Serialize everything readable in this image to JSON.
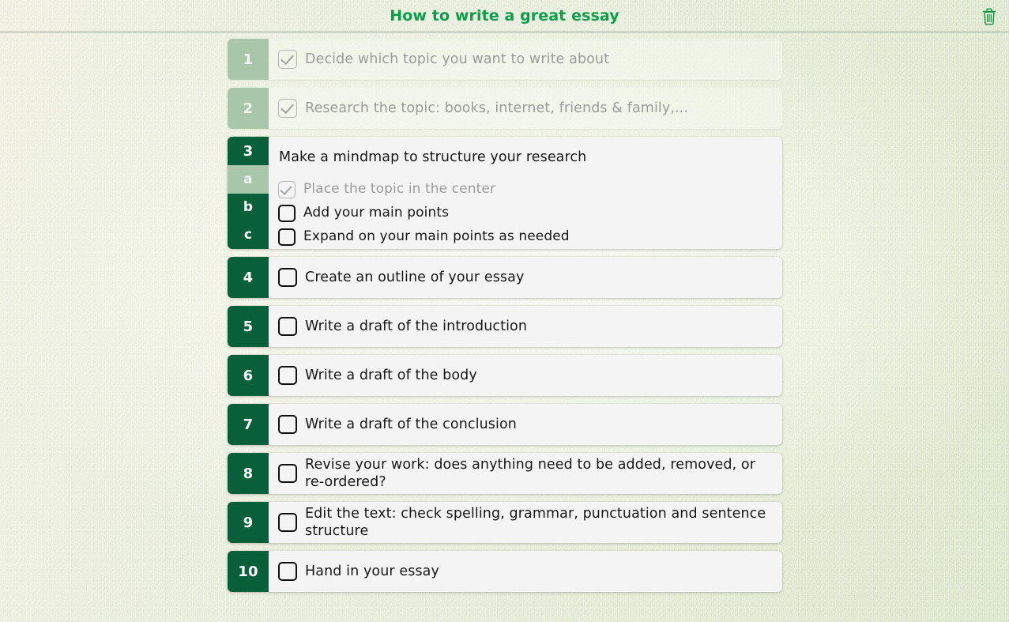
{
  "header": {
    "title": "How to write a great essay",
    "title_color": "#0a9e4a",
    "trash_icon": "trash-icon"
  },
  "theme": {
    "badge_active": "#08603a",
    "badge_done": "#a9c6ab",
    "card_bg": "#f4f4f4",
    "text_active": "#171717",
    "text_done": "#9b9b9b",
    "page_bg": "#eaeedb"
  },
  "checklist": {
    "items": [
      {
        "number": "1",
        "label": "Decide which topic you want to write about",
        "done": true,
        "has_checkbox": true,
        "subitems": []
      },
      {
        "number": "2",
        "label": "Research the topic: books, internet, friends & family,...",
        "done": true,
        "has_checkbox": true,
        "subitems": []
      },
      {
        "number": "3",
        "label": "Make a mindmap to structure your research",
        "done": false,
        "has_checkbox": false,
        "subitems": [
          {
            "number": "a",
            "label": "Place the topic in the center",
            "done": true
          },
          {
            "number": "b",
            "label": "Add your main points",
            "done": false
          },
          {
            "number": "c",
            "label": "Expand on your main points as needed",
            "done": false
          }
        ]
      },
      {
        "number": "4",
        "label": "Create an outline of your essay",
        "done": false,
        "has_checkbox": true,
        "subitems": []
      },
      {
        "number": "5",
        "label": "Write a draft of the introduction",
        "done": false,
        "has_checkbox": true,
        "subitems": []
      },
      {
        "number": "6",
        "label": "Write a draft of the body",
        "done": false,
        "has_checkbox": true,
        "subitems": []
      },
      {
        "number": "7",
        "label": "Write a draft of the conclusion",
        "done": false,
        "has_checkbox": true,
        "subitems": []
      },
      {
        "number": "8",
        "label": "Revise your work: does anything need to be added, removed, or re-ordered?",
        "done": false,
        "has_checkbox": true,
        "subitems": []
      },
      {
        "number": "9",
        "label": "Edit the text: check spelling, grammar, punctuation and sentence structure",
        "done": false,
        "has_checkbox": true,
        "subitems": []
      },
      {
        "number": "10",
        "label": "Hand in your essay",
        "done": false,
        "has_checkbox": true,
        "subitems": []
      }
    ]
  }
}
